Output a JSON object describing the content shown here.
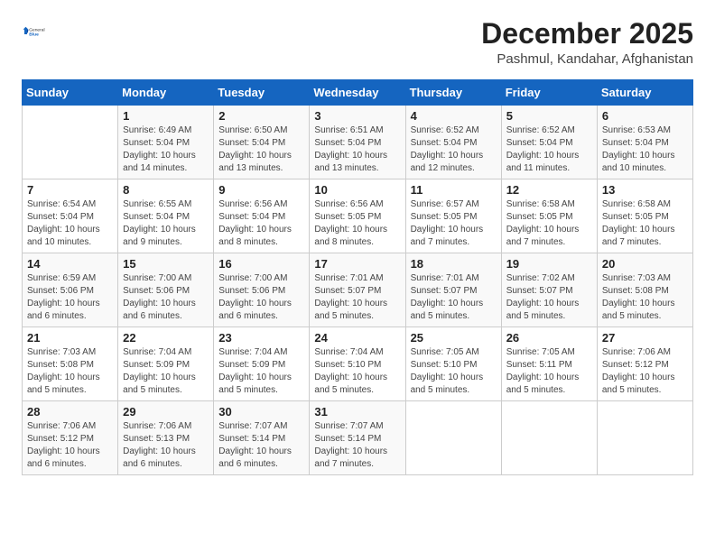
{
  "header": {
    "logo_general": "General",
    "logo_blue": "Blue",
    "month": "December 2025",
    "location": "Pashmul, Kandahar, Afghanistan"
  },
  "weekdays": [
    "Sunday",
    "Monday",
    "Tuesday",
    "Wednesday",
    "Thursday",
    "Friday",
    "Saturday"
  ],
  "weeks": [
    [
      {
        "day": "",
        "detail": ""
      },
      {
        "day": "1",
        "detail": "Sunrise: 6:49 AM\nSunset: 5:04 PM\nDaylight: 10 hours\nand 14 minutes."
      },
      {
        "day": "2",
        "detail": "Sunrise: 6:50 AM\nSunset: 5:04 PM\nDaylight: 10 hours\nand 13 minutes."
      },
      {
        "day": "3",
        "detail": "Sunrise: 6:51 AM\nSunset: 5:04 PM\nDaylight: 10 hours\nand 13 minutes."
      },
      {
        "day": "4",
        "detail": "Sunrise: 6:52 AM\nSunset: 5:04 PM\nDaylight: 10 hours\nand 12 minutes."
      },
      {
        "day": "5",
        "detail": "Sunrise: 6:52 AM\nSunset: 5:04 PM\nDaylight: 10 hours\nand 11 minutes."
      },
      {
        "day": "6",
        "detail": "Sunrise: 6:53 AM\nSunset: 5:04 PM\nDaylight: 10 hours\nand 10 minutes."
      }
    ],
    [
      {
        "day": "7",
        "detail": "Sunrise: 6:54 AM\nSunset: 5:04 PM\nDaylight: 10 hours\nand 10 minutes."
      },
      {
        "day": "8",
        "detail": "Sunrise: 6:55 AM\nSunset: 5:04 PM\nDaylight: 10 hours\nand 9 minutes."
      },
      {
        "day": "9",
        "detail": "Sunrise: 6:56 AM\nSunset: 5:04 PM\nDaylight: 10 hours\nand 8 minutes."
      },
      {
        "day": "10",
        "detail": "Sunrise: 6:56 AM\nSunset: 5:05 PM\nDaylight: 10 hours\nand 8 minutes."
      },
      {
        "day": "11",
        "detail": "Sunrise: 6:57 AM\nSunset: 5:05 PM\nDaylight: 10 hours\nand 7 minutes."
      },
      {
        "day": "12",
        "detail": "Sunrise: 6:58 AM\nSunset: 5:05 PM\nDaylight: 10 hours\nand 7 minutes."
      },
      {
        "day": "13",
        "detail": "Sunrise: 6:58 AM\nSunset: 5:05 PM\nDaylight: 10 hours\nand 7 minutes."
      }
    ],
    [
      {
        "day": "14",
        "detail": "Sunrise: 6:59 AM\nSunset: 5:06 PM\nDaylight: 10 hours\nand 6 minutes."
      },
      {
        "day": "15",
        "detail": "Sunrise: 7:00 AM\nSunset: 5:06 PM\nDaylight: 10 hours\nand 6 minutes."
      },
      {
        "day": "16",
        "detail": "Sunrise: 7:00 AM\nSunset: 5:06 PM\nDaylight: 10 hours\nand 6 minutes."
      },
      {
        "day": "17",
        "detail": "Sunrise: 7:01 AM\nSunset: 5:07 PM\nDaylight: 10 hours\nand 5 minutes."
      },
      {
        "day": "18",
        "detail": "Sunrise: 7:01 AM\nSunset: 5:07 PM\nDaylight: 10 hours\nand 5 minutes."
      },
      {
        "day": "19",
        "detail": "Sunrise: 7:02 AM\nSunset: 5:07 PM\nDaylight: 10 hours\nand 5 minutes."
      },
      {
        "day": "20",
        "detail": "Sunrise: 7:03 AM\nSunset: 5:08 PM\nDaylight: 10 hours\nand 5 minutes."
      }
    ],
    [
      {
        "day": "21",
        "detail": "Sunrise: 7:03 AM\nSunset: 5:08 PM\nDaylight: 10 hours\nand 5 minutes."
      },
      {
        "day": "22",
        "detail": "Sunrise: 7:04 AM\nSunset: 5:09 PM\nDaylight: 10 hours\nand 5 minutes."
      },
      {
        "day": "23",
        "detail": "Sunrise: 7:04 AM\nSunset: 5:09 PM\nDaylight: 10 hours\nand 5 minutes."
      },
      {
        "day": "24",
        "detail": "Sunrise: 7:04 AM\nSunset: 5:10 PM\nDaylight: 10 hours\nand 5 minutes."
      },
      {
        "day": "25",
        "detail": "Sunrise: 7:05 AM\nSunset: 5:10 PM\nDaylight: 10 hours\nand 5 minutes."
      },
      {
        "day": "26",
        "detail": "Sunrise: 7:05 AM\nSunset: 5:11 PM\nDaylight: 10 hours\nand 5 minutes."
      },
      {
        "day": "27",
        "detail": "Sunrise: 7:06 AM\nSunset: 5:12 PM\nDaylight: 10 hours\nand 5 minutes."
      }
    ],
    [
      {
        "day": "28",
        "detail": "Sunrise: 7:06 AM\nSunset: 5:12 PM\nDaylight: 10 hours\nand 6 minutes."
      },
      {
        "day": "29",
        "detail": "Sunrise: 7:06 AM\nSunset: 5:13 PM\nDaylight: 10 hours\nand 6 minutes."
      },
      {
        "day": "30",
        "detail": "Sunrise: 7:07 AM\nSunset: 5:14 PM\nDaylight: 10 hours\nand 6 minutes."
      },
      {
        "day": "31",
        "detail": "Sunrise: 7:07 AM\nSunset: 5:14 PM\nDaylight: 10 hours\nand 7 minutes."
      },
      {
        "day": "",
        "detail": ""
      },
      {
        "day": "",
        "detail": ""
      },
      {
        "day": "",
        "detail": ""
      }
    ]
  ]
}
